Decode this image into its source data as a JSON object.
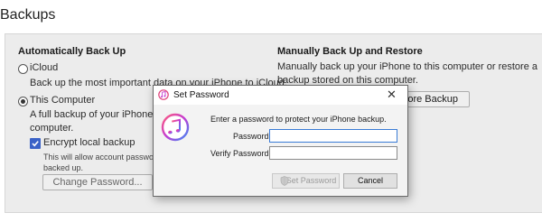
{
  "page": {
    "title": "Backups"
  },
  "auto_backup": {
    "heading": "Automatically Back Up",
    "icloud_label": "iCloud",
    "icloud_desc": "Back up the most important data on your iPhone to iCloud.",
    "icloud_selected": false,
    "computer_label": "This Computer",
    "computer_desc_line1": "A full backup of your iPhone w",
    "computer_desc_line2": "computer.",
    "computer_selected": true,
    "encrypt_label": "Encrypt local backup",
    "encrypt_checked": true,
    "encrypt_desc_line1": "This will allow account passwords,",
    "encrypt_desc_line2": "backed up.",
    "change_password_label": "Change Password..."
  },
  "manual_backup": {
    "heading": "Manually Back Up and Restore",
    "desc_line1": "Manually back up your iPhone to this computer or restore a",
    "desc_line2": "backup stored on this computer.",
    "restore_button_label": "tore Backup"
  },
  "dialog": {
    "title": "Set Password",
    "prompt": "Enter a password to protect your iPhone backup.",
    "password_label": "Password:",
    "password_value": "",
    "verify_label": "Verify Password:",
    "verify_value": "",
    "set_password_label": "Set Password",
    "cancel_label": "Cancel",
    "close_glyph": "✕",
    "app_icon": "itunes-icon",
    "shield_icon": "uac-shield-icon"
  },
  "colors": {
    "accent": "#3a62c7",
    "panel_bg": "#ececec",
    "focus_border": "#3a7bd5"
  }
}
